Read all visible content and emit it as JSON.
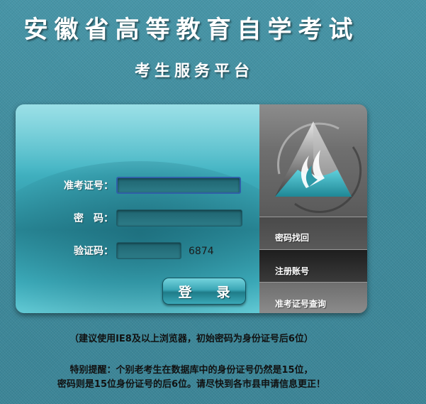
{
  "header": {
    "title": "安徽省高等教育自学考试",
    "subtitle": "考生服务平台"
  },
  "login_form": {
    "exam_id_label": "准考证号：",
    "exam_id_value": "",
    "password_label": "密　码：",
    "password_value": "",
    "captcha_label": "验证码：",
    "captcha_value": "",
    "captcha_code": "6874",
    "login_button": "登　录"
  },
  "side_menu": {
    "logo_icon": "mountain-flame-logo-icon",
    "items": [
      {
        "label": "密码找回"
      },
      {
        "label": "注册账号"
      },
      {
        "label": "准考证号查询"
      }
    ]
  },
  "notes": {
    "browser_tip": "（建议使用IE8及以上浏览器，初始密码为身份证号后6位）",
    "reminder_line1": "特别提醒：个别老考生在数据库中的身份证号仍然是15位，",
    "reminder_line2": "密码则是15位身份证号的后6位。请尽快到各市县申请信息更正！"
  },
  "colors": {
    "background": "#3f8a9c",
    "panel_teal": "#43b5c4",
    "menu_gray": "#555555",
    "button_teal": "#3aa6b5"
  }
}
